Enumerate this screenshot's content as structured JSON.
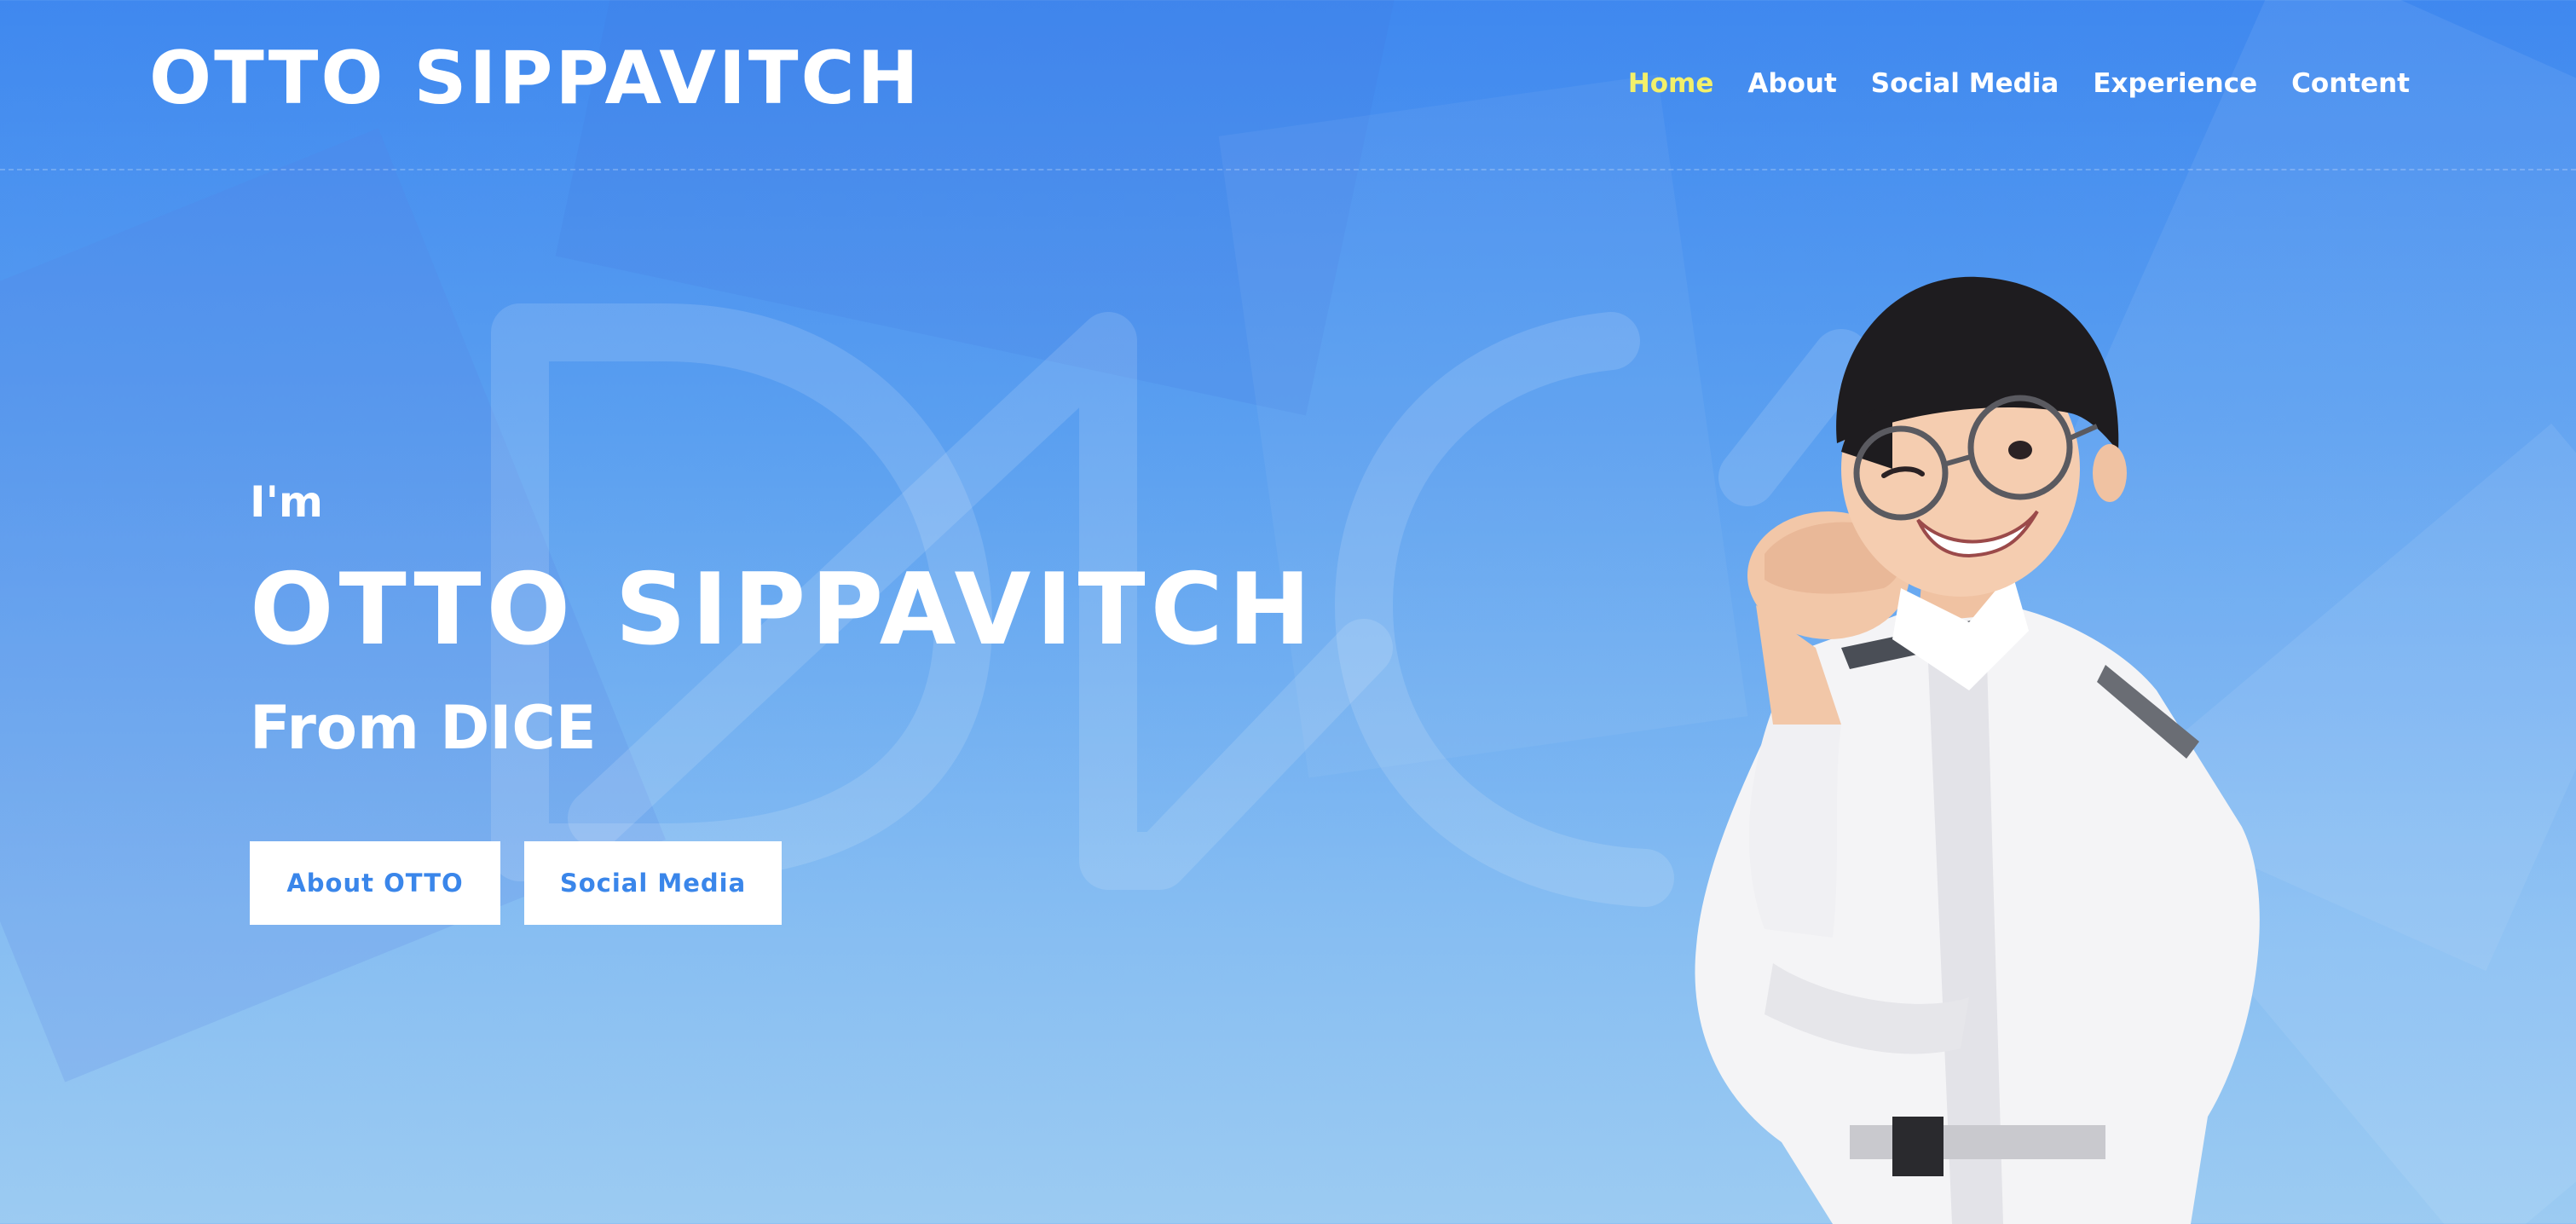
{
  "header": {
    "logo": "OTTO SIPPAVITCH",
    "nav": [
      {
        "label": "Home",
        "active": true
      },
      {
        "label": "About",
        "active": false
      },
      {
        "label": "Social Media",
        "active": false
      },
      {
        "label": "Experience",
        "active": false
      },
      {
        "label": "Content",
        "active": false
      }
    ]
  },
  "hero": {
    "intro": "I'm",
    "name": "OTTO SIPPAVITCH",
    "subtitle": "From DICE",
    "buttons": {
      "about": "About OTTO",
      "social": "Social Media"
    }
  },
  "colors": {
    "accent": "#3a86ea",
    "nav_active": "#f3f06a",
    "background_top": "#3f88ef",
    "background_bottom": "#9ccbf2"
  }
}
